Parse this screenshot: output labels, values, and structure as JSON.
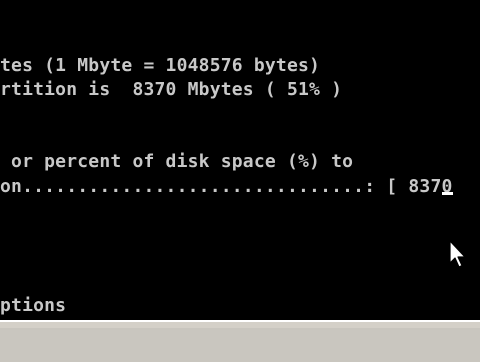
{
  "console": {
    "lines": [
      "tes (1 Mbyte = 1048576 bytes)",
      "rtition is  8370 Mbytes ( 51% )",
      " or percent of disk space (%) to",
      "on...............................: [ 8370",
      "ptions"
    ],
    "partition_size_value": "8370",
    "partition_percent": "51%",
    "input_field_value": "8370",
    "text_color": "#c8c8c8",
    "highlight_color": "#ffffff",
    "background_color": "#000000"
  },
  "taskbar": {
    "color": "#d4d0c8"
  },
  "icons": {
    "pointer": "mouse-pointer-icon"
  }
}
